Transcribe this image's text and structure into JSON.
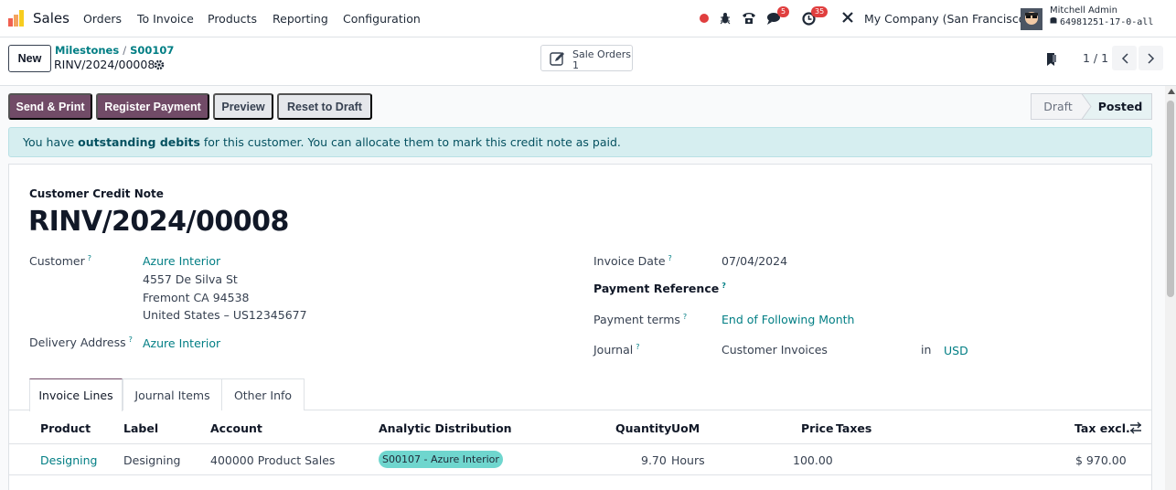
{
  "navbar": {
    "app_name": "Sales",
    "menus": [
      "Orders",
      "To Invoice",
      "Products",
      "Reporting",
      "Configuration"
    ],
    "messages_count": "5",
    "activities_count": "35",
    "company": "My Company (San Francisco)",
    "user_name": "Mitchell Admin",
    "database": "64981251-17-0-all"
  },
  "control_panel": {
    "new_label": "New",
    "breadcrumb_parent": "Milestones",
    "breadcrumb_order": "S00107",
    "record_name": "RINV/2024/00008",
    "smart_button_label": "Sale Orders",
    "smart_button_count": "1",
    "pager": "1 / 1"
  },
  "actions": {
    "send_print": "Send & Print",
    "register_payment": "Register Payment",
    "preview": "Preview",
    "reset_draft": "Reset to Draft"
  },
  "status": {
    "stages": [
      "Draft",
      "Posted"
    ],
    "current": "Posted"
  },
  "alert": {
    "prefix": "You have ",
    "bold": "outstanding debits",
    "suffix": " for this customer. You can allocate them to mark this credit note as paid."
  },
  "form": {
    "type_label": "Customer Credit Note",
    "title": "RINV/2024/00008",
    "customer_label": "Customer",
    "customer_name": "Azure Interior",
    "address_line1": "4557 De Silva St",
    "address_line2": "Fremont CA 94538",
    "address_line3": "United States – US12345677",
    "delivery_label": "Delivery Address",
    "delivery_value": "Azure Interior",
    "invoice_date_label": "Invoice Date",
    "invoice_date": "07/04/2024",
    "payment_ref_label": "Payment Reference",
    "payment_terms_label": "Payment terms",
    "payment_terms": "End of Following Month",
    "journal_label": "Journal",
    "journal": "Customer Invoices",
    "in_label": "in",
    "currency": "USD",
    "help_mark": "?"
  },
  "tabs": [
    "Invoice Lines",
    "Journal Items",
    "Other Info"
  ],
  "table": {
    "headers": {
      "product": "Product",
      "label": "Label",
      "account": "Account",
      "analytic": "Analytic Distribution",
      "quantity": "Quantity",
      "uom": "UoM",
      "price": "Price",
      "taxes": "Taxes",
      "tax_excl": "Tax excl."
    },
    "rows": [
      {
        "product": "Designing",
        "label": "Designing",
        "account": "400000 Product Sales",
        "analytic": "S00107 - Azure Interior",
        "quantity": "9.70",
        "uom": "Hours",
        "price": "100.00",
        "taxes": "",
        "tax_excl": "$ 970.00"
      }
    ]
  },
  "colors": {
    "primary": "#714b67",
    "link": "#017e84",
    "alert_bg": "#d6eef0",
    "tag_bg": "#6fd6ce"
  }
}
